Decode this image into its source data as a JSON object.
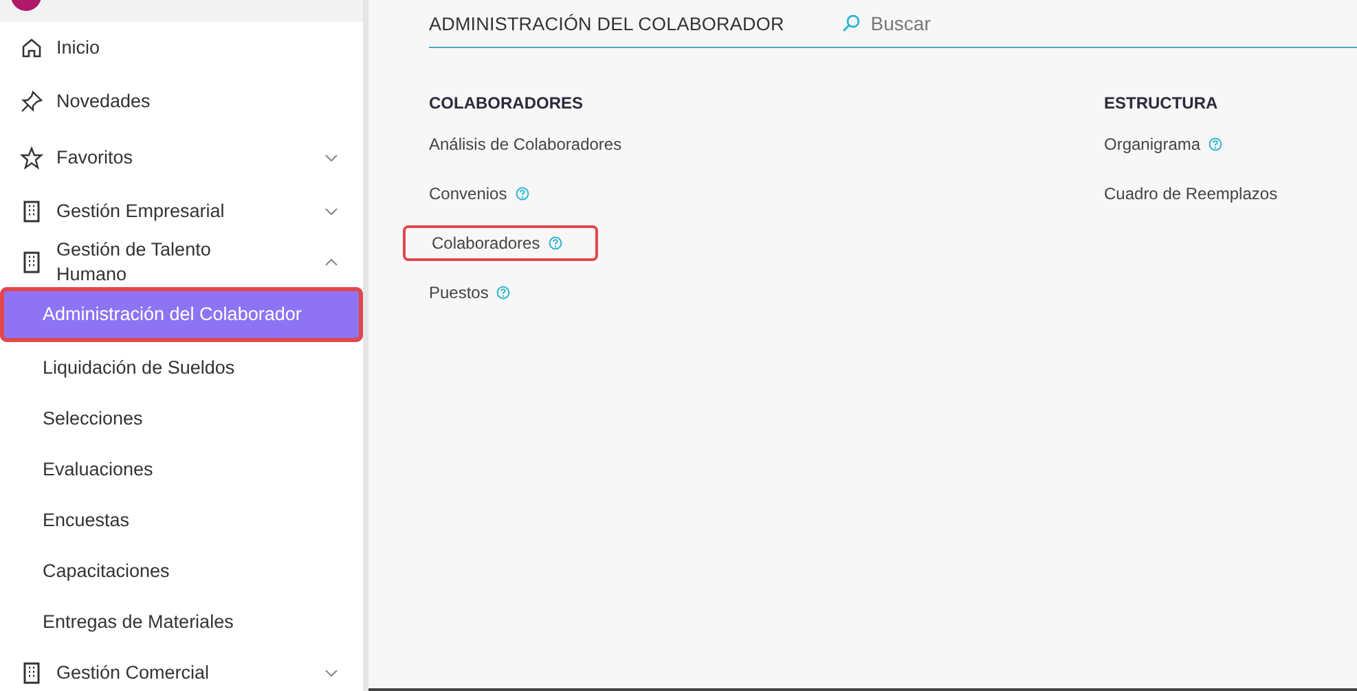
{
  "sidebar": {
    "items": [
      {
        "label": "Inicio"
      },
      {
        "label": "Novedades"
      },
      {
        "label": "Favoritos",
        "expanded": false
      },
      {
        "label": "Gestión Empresarial",
        "expanded": false
      },
      {
        "label": "Gestión de Talento Humano",
        "expanded": true,
        "children": [
          {
            "label": "Administración del Colaborador",
            "selected": true,
            "highlighted": true
          },
          {
            "label": "Liquidación de Sueldos",
            "selected": false,
            "highlighted": false
          },
          {
            "label": "Selecciones",
            "selected": false,
            "highlighted": false
          },
          {
            "label": "Evaluaciones",
            "selected": false,
            "highlighted": false
          },
          {
            "label": "Encuestas",
            "selected": false,
            "highlighted": false
          },
          {
            "label": "Capacitaciones",
            "selected": false,
            "highlighted": false
          },
          {
            "label": "Entregas de Materiales",
            "selected": false,
            "highlighted": false
          }
        ]
      },
      {
        "label": "Gestión Comercial",
        "expanded": false
      }
    ]
  },
  "main": {
    "title": "ADMINISTRACIÓN DEL COLABORADOR",
    "search": {
      "placeholder": "Buscar"
    },
    "sections": [
      {
        "heading": "COLABORADORES",
        "links": [
          {
            "label": "Análisis de Colaboradores",
            "help": false,
            "highlighted": false
          },
          {
            "label": "Convenios",
            "help": true,
            "highlighted": false
          },
          {
            "label": "Colaboradores",
            "help": true,
            "highlighted": true
          },
          {
            "label": "Puestos",
            "help": true,
            "highlighted": false
          }
        ]
      },
      {
        "heading": "ESTRUCTURA",
        "links": [
          {
            "label": "Organigrama",
            "help": true,
            "highlighted": false
          },
          {
            "label": "Cuadro de Reemplazos",
            "help": false,
            "highlighted": false
          }
        ]
      }
    ]
  }
}
